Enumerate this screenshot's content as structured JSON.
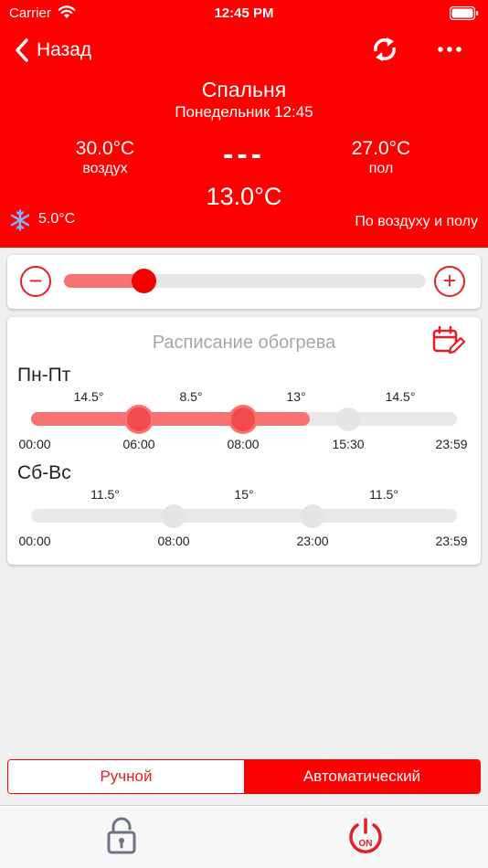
{
  "status_bar": {
    "carrier": "Carrier",
    "time": "12:45 PM"
  },
  "nav": {
    "back_label": "Назад",
    "refresh_icon": "refresh-icon",
    "more_icon": "more-icon"
  },
  "room": {
    "name": "Спальня",
    "datetime": "Понедельник 12:45",
    "air_temp": "30.0°C",
    "air_label": "воздух",
    "floor_temp": "27.0°C",
    "floor_label": "пол",
    "center_value": "---",
    "setpoint": "13.0°C",
    "frost_temp": "5.0°C",
    "sensor_mode": "По воздуху и полу"
  },
  "setpoint_slider": {
    "value_fraction": 0.22
  },
  "schedule": {
    "title": "Расписание обогрева",
    "groups": [
      {
        "label": "Пн-Пт",
        "temps": [
          "14.5°",
          "8.5°",
          "13°",
          "14.5°"
        ],
        "times": [
          "00:00",
          "06:00",
          "08:00",
          "15:30",
          "23:59"
        ],
        "active_until_fraction": 0.655
      },
      {
        "label": "Сб-Вс",
        "temps": [
          "11.5°",
          "15°",
          "11.5°"
        ],
        "times": [
          "00:00",
          "08:00",
          "23:00",
          "23:59"
        ],
        "active_until_fraction": 0
      }
    ]
  },
  "mode": {
    "manual": "Ручной",
    "automatic": "Автоматический",
    "selected": "automatic"
  },
  "bottom": {
    "power_badge": "ON"
  },
  "colors": {
    "brand_red": "#fd0000",
    "slider_fill": "#f87171",
    "accent": "#e51d24"
  }
}
